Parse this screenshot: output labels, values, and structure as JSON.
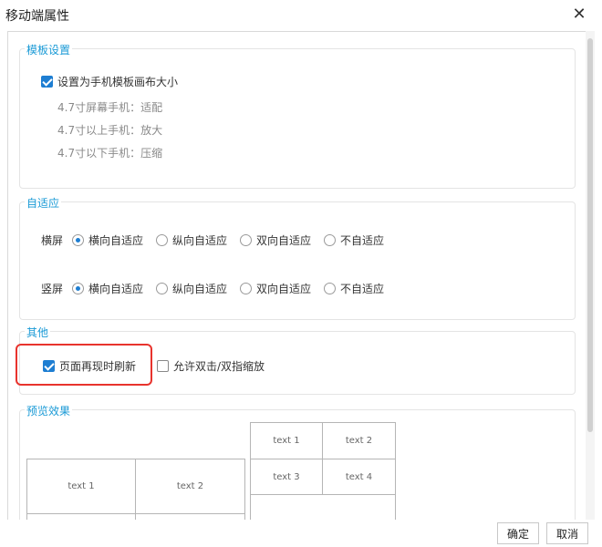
{
  "window": {
    "title": "移动端属性",
    "close_glyph": "✕"
  },
  "template": {
    "section_title": "模板设置",
    "checkbox_label": "设置为手机模板画布大小",
    "checked": true,
    "notes": [
      "4.7寸屏幕手机：适配",
      "4.7寸以上手机：放大",
      "4.7寸以下手机：压缩"
    ]
  },
  "adaptive": {
    "section_title": "自适应",
    "options": [
      "横向自适应",
      "纵向自适应",
      "双向自适应",
      "不自适应"
    ],
    "landscape": {
      "label": "横屏",
      "selected": "横向自适应"
    },
    "portrait": {
      "label": "竖屏",
      "selected": "横向自适应"
    }
  },
  "other": {
    "section_title": "其他",
    "refresh_label": "页面再现时刷新",
    "refresh_checked": true,
    "zoom_label": "允许双击/双指缩放",
    "zoom_checked": false
  },
  "preview": {
    "section_title": "预览效果",
    "left_cells": [
      "text 1",
      "text 2"
    ],
    "right_cells": [
      "text 1",
      "text 2",
      "text 3",
      "text 4"
    ]
  },
  "footer": {
    "ok_label": "确定",
    "cancel_label": "取消"
  },
  "colors": {
    "accent": "#1a9ad6",
    "check": "#1e7ed2",
    "highlight": "#e8332d"
  }
}
